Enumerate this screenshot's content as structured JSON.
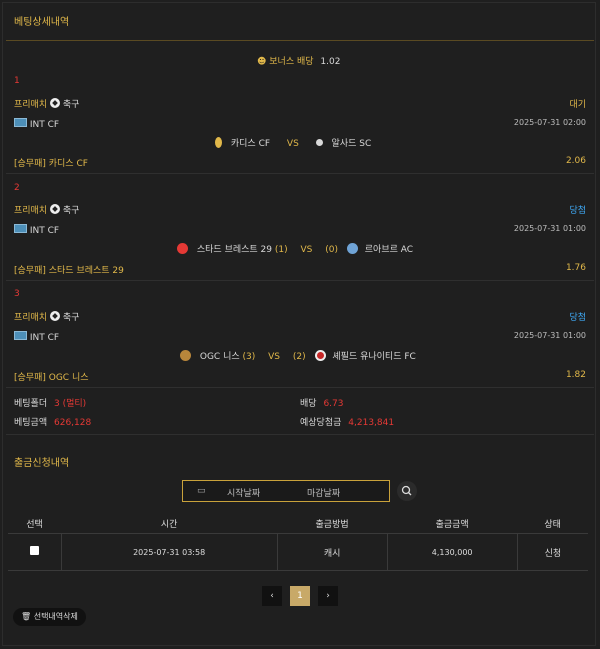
{
  "bet_detail": {
    "title": "베팅상세내역",
    "bonus_label": "보너스 배당",
    "bonus_value": "1.02",
    "bets": [
      {
        "index": "1",
        "category": "프리매치",
        "sport": "축구",
        "status": "대기",
        "league": "INT CF",
        "datetime": "2025-07-31 02:00",
        "home": "카디스 CF",
        "home_score": "",
        "vs": "VS",
        "away_score": "",
        "away": "알사드 SC",
        "pick_market": "[승무패]",
        "pick_team": "카디스 CF",
        "odds": "2.06"
      },
      {
        "index": "2",
        "category": "프리매치",
        "sport": "축구",
        "status": "당첨",
        "league": "INT CF",
        "datetime": "2025-07-31 01:00",
        "home": "스타드 브레스트 29",
        "home_score": "(1)",
        "vs": "VS",
        "away_score": "(0)",
        "away": "르아브르 AC",
        "pick_market": "[승무패]",
        "pick_team": "스타드 브레스트 29",
        "odds": "1.76"
      },
      {
        "index": "3",
        "category": "프리매치",
        "sport": "축구",
        "status": "당첨",
        "league": "INT CF",
        "datetime": "2025-07-31 01:00",
        "home": "OGC 니스",
        "home_score": "(3)",
        "vs": "VS",
        "away_score": "(2)",
        "away": "셰필드 유나이티드 FC",
        "pick_market": "[승무패]",
        "pick_team": "OGC 니스",
        "odds": "1.82"
      }
    ],
    "summary": {
      "folder_label": "베팅폴더",
      "folder_value": "3 (멀티)",
      "odds_label": "배당",
      "odds_value": "6.73",
      "amount_label": "베팅금액",
      "amount_value": "626,128",
      "expected_label": "예상당첨금",
      "expected_value": "4,213,841"
    }
  },
  "withdraw": {
    "title": "출금신청내역",
    "start_placeholder": "시작날짜",
    "end_placeholder": "마감날짜",
    "columns": [
      "선택",
      "시간",
      "출금방법",
      "출금금액",
      "상태"
    ],
    "rows": [
      {
        "time": "2025-07-31 03:58",
        "method": "캐시",
        "amount": "4,130,000",
        "status": "신청"
      }
    ],
    "pagination": {
      "prev": "‹",
      "current": "1",
      "next": "›"
    },
    "delete_label": "선택내역삭제"
  },
  "colors": {
    "accent": "#e1b84a",
    "red": "#e53935",
    "win": "#3fa9f5",
    "background": "#1f1f1f"
  }
}
